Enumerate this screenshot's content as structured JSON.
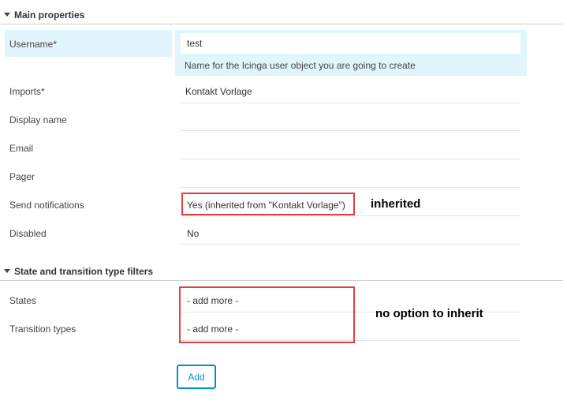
{
  "sections": {
    "main": "Main properties",
    "filters": "State and transition type filters"
  },
  "fields": {
    "username": {
      "label": "Username*",
      "value": "test",
      "hint": "Name for the Icinga user object you are going to create"
    },
    "imports": {
      "label": "Imports*",
      "value": "Kontakt Vorlage"
    },
    "display_name": {
      "label": "Display name",
      "value": ""
    },
    "email": {
      "label": "Email",
      "value": ""
    },
    "pager": {
      "label": "Pager",
      "value": ""
    },
    "send_notifications": {
      "label": "Send notifications",
      "value": "Yes (inherited from \"Kontakt Vorlage\")"
    },
    "disabled": {
      "label": "Disabled",
      "value": "No"
    },
    "states": {
      "label": "States",
      "value": "- add more -"
    },
    "transition_types": {
      "label": "Transition types",
      "value": "- add more -"
    }
  },
  "annotations": {
    "inherited": "inherited",
    "no_inherit": "no option to inherit"
  },
  "buttons": {
    "add": "Add"
  },
  "colors": {
    "active_bg": "#e1f5fc",
    "accent": "#0095bf",
    "annotation_box": "#e04040"
  }
}
